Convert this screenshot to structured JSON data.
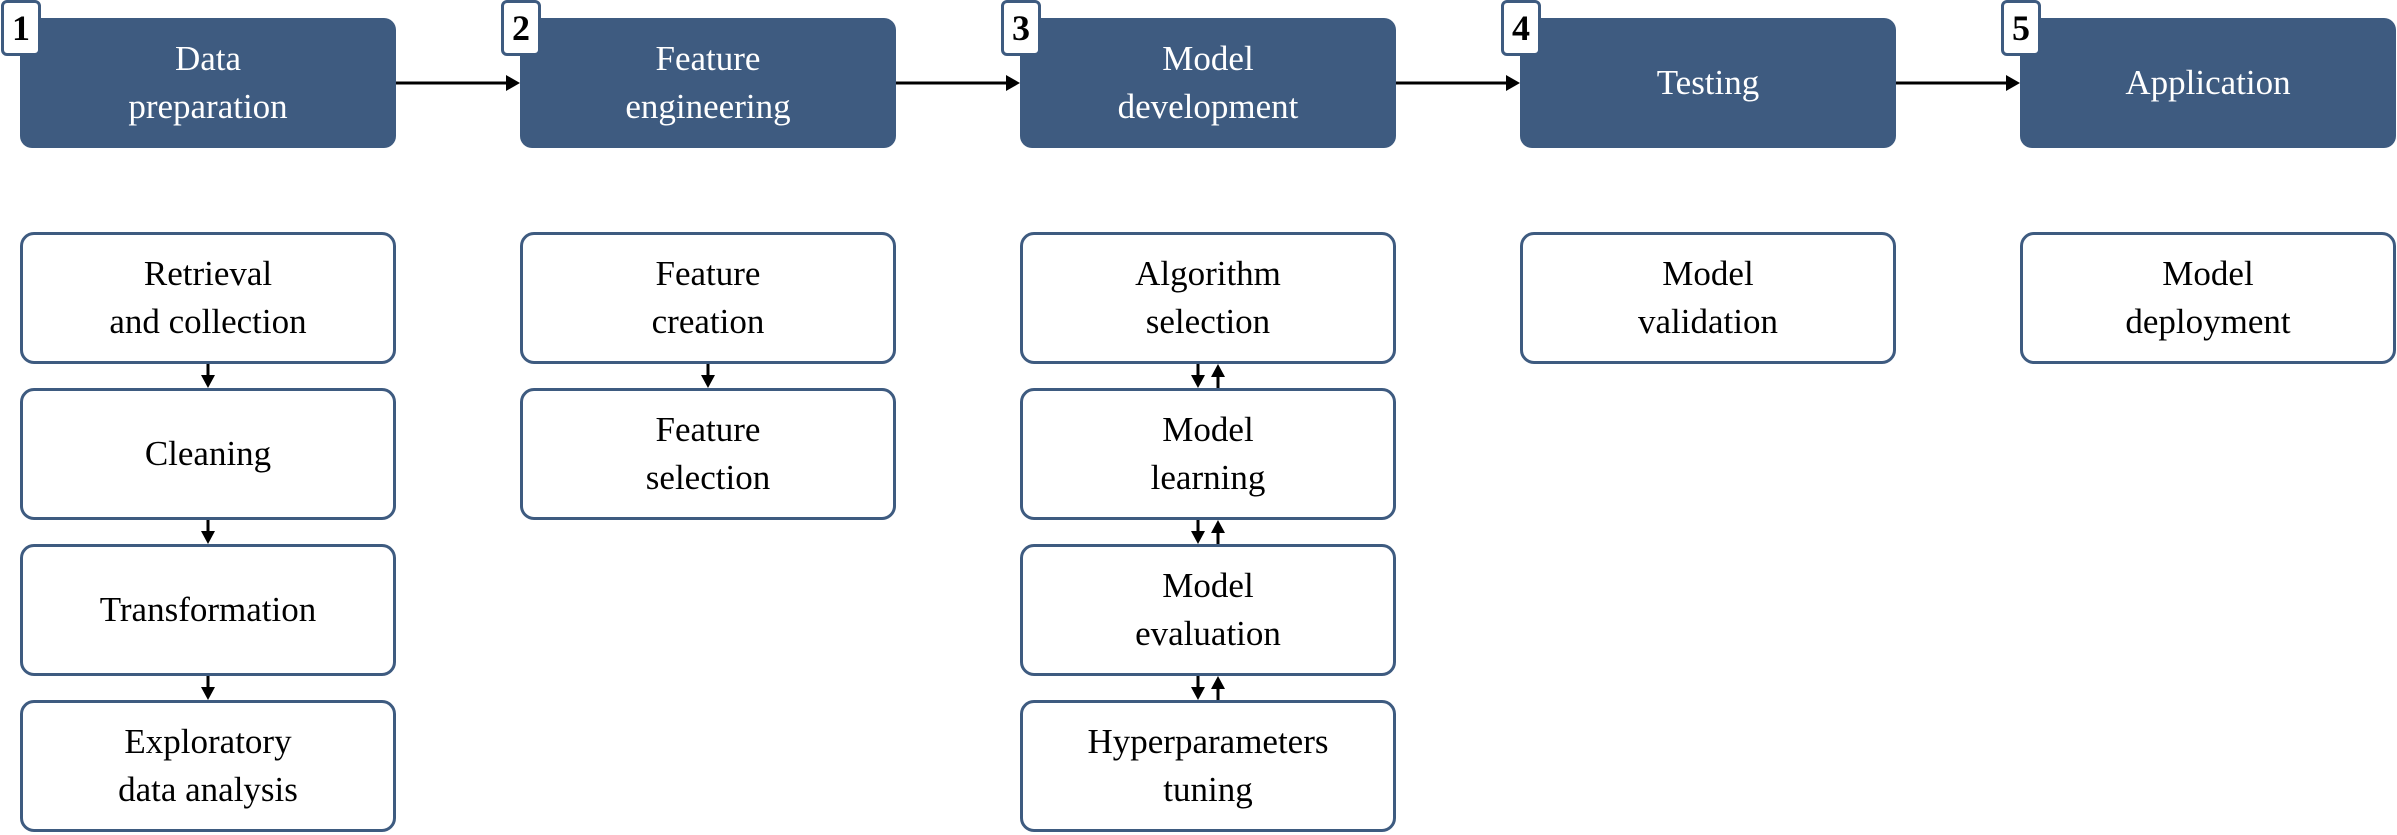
{
  "colors": {
    "stage_fill": "#3e5b80",
    "border": "#3e5b80",
    "arrow": "#000000"
  },
  "stages": [
    {
      "number": "1",
      "title": "Data\npreparation",
      "steps": [
        "Retrieval\nand collection",
        "Cleaning",
        "Transformation",
        "Exploratory\ndata analysis"
      ],
      "step_links": "one-way"
    },
    {
      "number": "2",
      "title": "Feature\nengineering",
      "steps": [
        "Feature\ncreation",
        "Feature\nselection"
      ],
      "step_links": "one-way"
    },
    {
      "number": "3",
      "title": "Model\ndevelopment",
      "steps": [
        "Algorithm\nselection",
        "Model\nlearning",
        "Model\nevaluation",
        "Hyperparameters\ntuning"
      ],
      "step_links": "two-way"
    },
    {
      "number": "4",
      "title": "Testing",
      "steps": [
        "Model\nvalidation"
      ],
      "step_links": "one-way"
    },
    {
      "number": "5",
      "title": "Application",
      "steps": [
        "Model\ndeployment"
      ],
      "step_links": "one-way"
    }
  ]
}
